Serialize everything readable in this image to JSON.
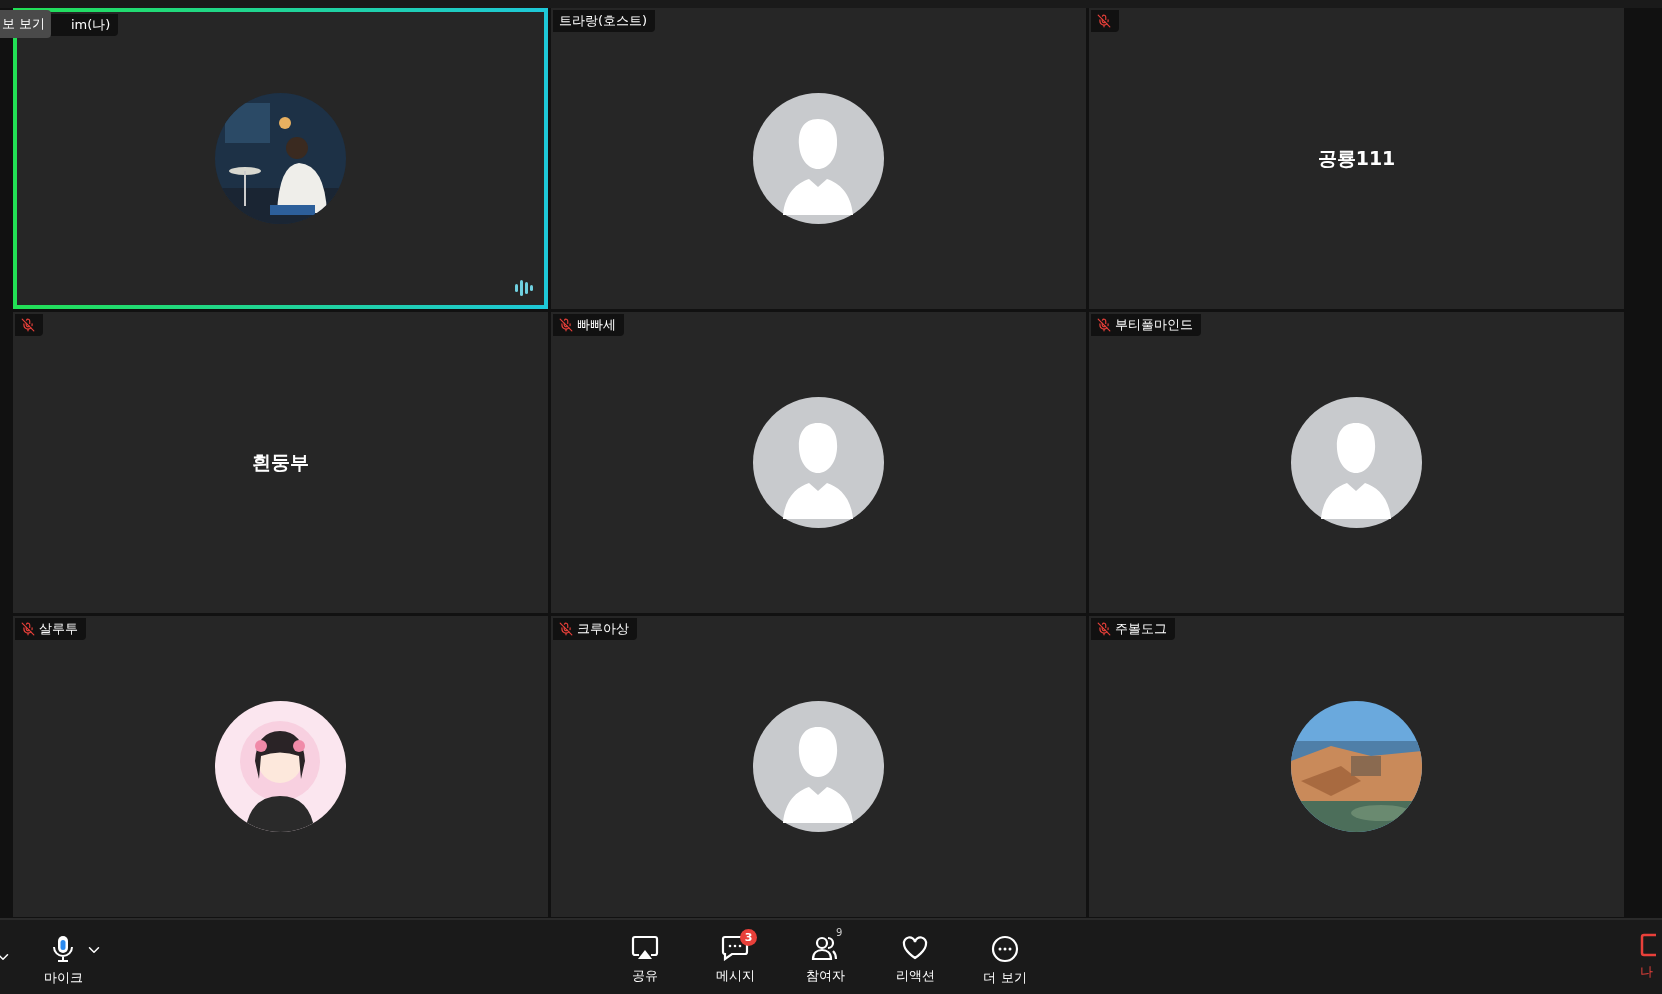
{
  "tooltip": {
    "text": "보 보기"
  },
  "tiles": [
    {
      "label": "im(나)",
      "muted": false,
      "speaking": true
    },
    {
      "label": "트라랑(호스트)",
      "muted": false,
      "speaking": false,
      "kind": "default"
    },
    {
      "muted": true,
      "speaking": false,
      "kind": "name",
      "name": "공룡111"
    },
    {
      "muted": true,
      "speaking": false,
      "kind": "name",
      "name": "흰둥부"
    },
    {
      "label": "빠빠세",
      "muted": true,
      "speaking": false,
      "kind": "default"
    },
    {
      "label": "부티풀마인드",
      "muted": true,
      "speaking": false,
      "kind": "default"
    },
    {
      "label": "살루투",
      "muted": true,
      "speaking": false
    },
    {
      "label": "크루아상",
      "muted": true,
      "speaking": false,
      "kind": "default"
    },
    {
      "label": "주볼도그",
      "muted": true,
      "speaking": false
    }
  ],
  "toolbar": {
    "mic": {
      "label": "마이크"
    },
    "center": [
      {
        "kind": "share",
        "label": "공유"
      },
      {
        "kind": "chat",
        "label": "메시지",
        "badge": "3"
      },
      {
        "kind": "people",
        "label": "참여자",
        "count": "9"
      },
      {
        "kind": "heart",
        "label": "리액션"
      },
      {
        "kind": "more",
        "label": "더 보기"
      }
    ],
    "leave": {
      "label": "나"
    }
  }
}
